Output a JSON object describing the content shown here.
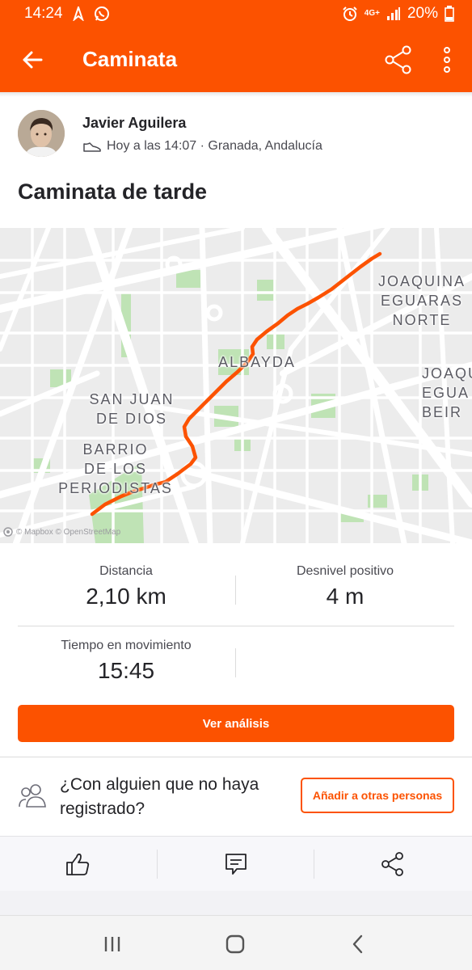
{
  "status_bar": {
    "time": "14:24",
    "network": "4G+",
    "battery": "20%"
  },
  "app_bar": {
    "title": "Caminata"
  },
  "activity": {
    "athlete_name": "Javier Aguilera",
    "meta": "Hoy a las 14:07 · Granada, Andalucía",
    "title": "Caminata de tarde"
  },
  "map": {
    "labels": {
      "joaquina_norte": "JOAQUINA\nEGUARAS\nNORTE",
      "albayda": "ALBAYDA",
      "joaquina_edge": "JOAQU\nEGUA\nBEIR",
      "san_juan": "SAN JUAN\nDE DIOS",
      "barrio": "BARRIO\nDE LOS\nPERIODISTAS"
    },
    "attribution": "© Mapbox © OpenStreetMap",
    "route_color": "#fc5200"
  },
  "stats": {
    "distance": {
      "label": "Distancia",
      "value": "2,10 km"
    },
    "elevation": {
      "label": "Desnivel positivo",
      "value": "4 m"
    },
    "moving_time": {
      "label": "Tiempo en movimiento",
      "value": "15:45"
    }
  },
  "buttons": {
    "analysis": "Ver análisis",
    "add_people": "Añadir a otras personas"
  },
  "group_prompt": "¿Con alguien que no haya registrado?",
  "icons": {
    "back": "arrow-left-icon",
    "share": "share-icon",
    "more": "more-vertical-icon",
    "shoe": "shoe-icon",
    "group": "people-icon",
    "kudos": "thumbs-up-icon",
    "comment": "comment-icon",
    "share_action": "share-icon"
  },
  "colors": {
    "brand": "#fc5200"
  }
}
